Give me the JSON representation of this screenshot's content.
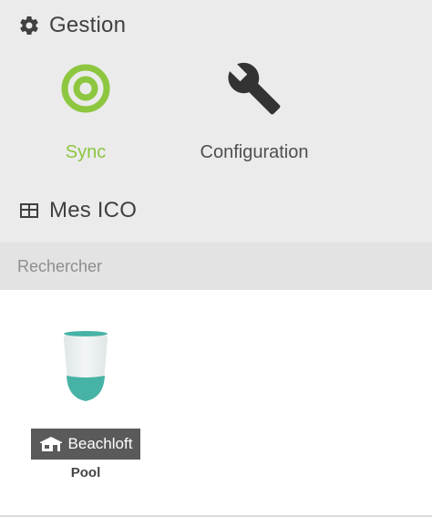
{
  "gestion": {
    "title": "Gestion",
    "icon": "gear-icon",
    "items": [
      {
        "label": "Sync",
        "icon": "sync-target-icon",
        "color": "#8dc63f"
      },
      {
        "label": "Configuration",
        "icon": "wrench-icon",
        "color": "#4f4f4f"
      }
    ]
  },
  "mes_ico": {
    "title": "Mes ICO",
    "icon": "table-icon"
  },
  "search": {
    "placeholder": "Rechercher",
    "value": ""
  },
  "devices": [
    {
      "location": "Beachloft",
      "location_icon": "home-icon",
      "name": "Pool",
      "image": "ico-device-image",
      "water_color": "#47b3a6"
    }
  ],
  "colors": {
    "background": "#ebebeb",
    "accent": "#8dc63f",
    "tag_background": "#5a5a5a"
  }
}
